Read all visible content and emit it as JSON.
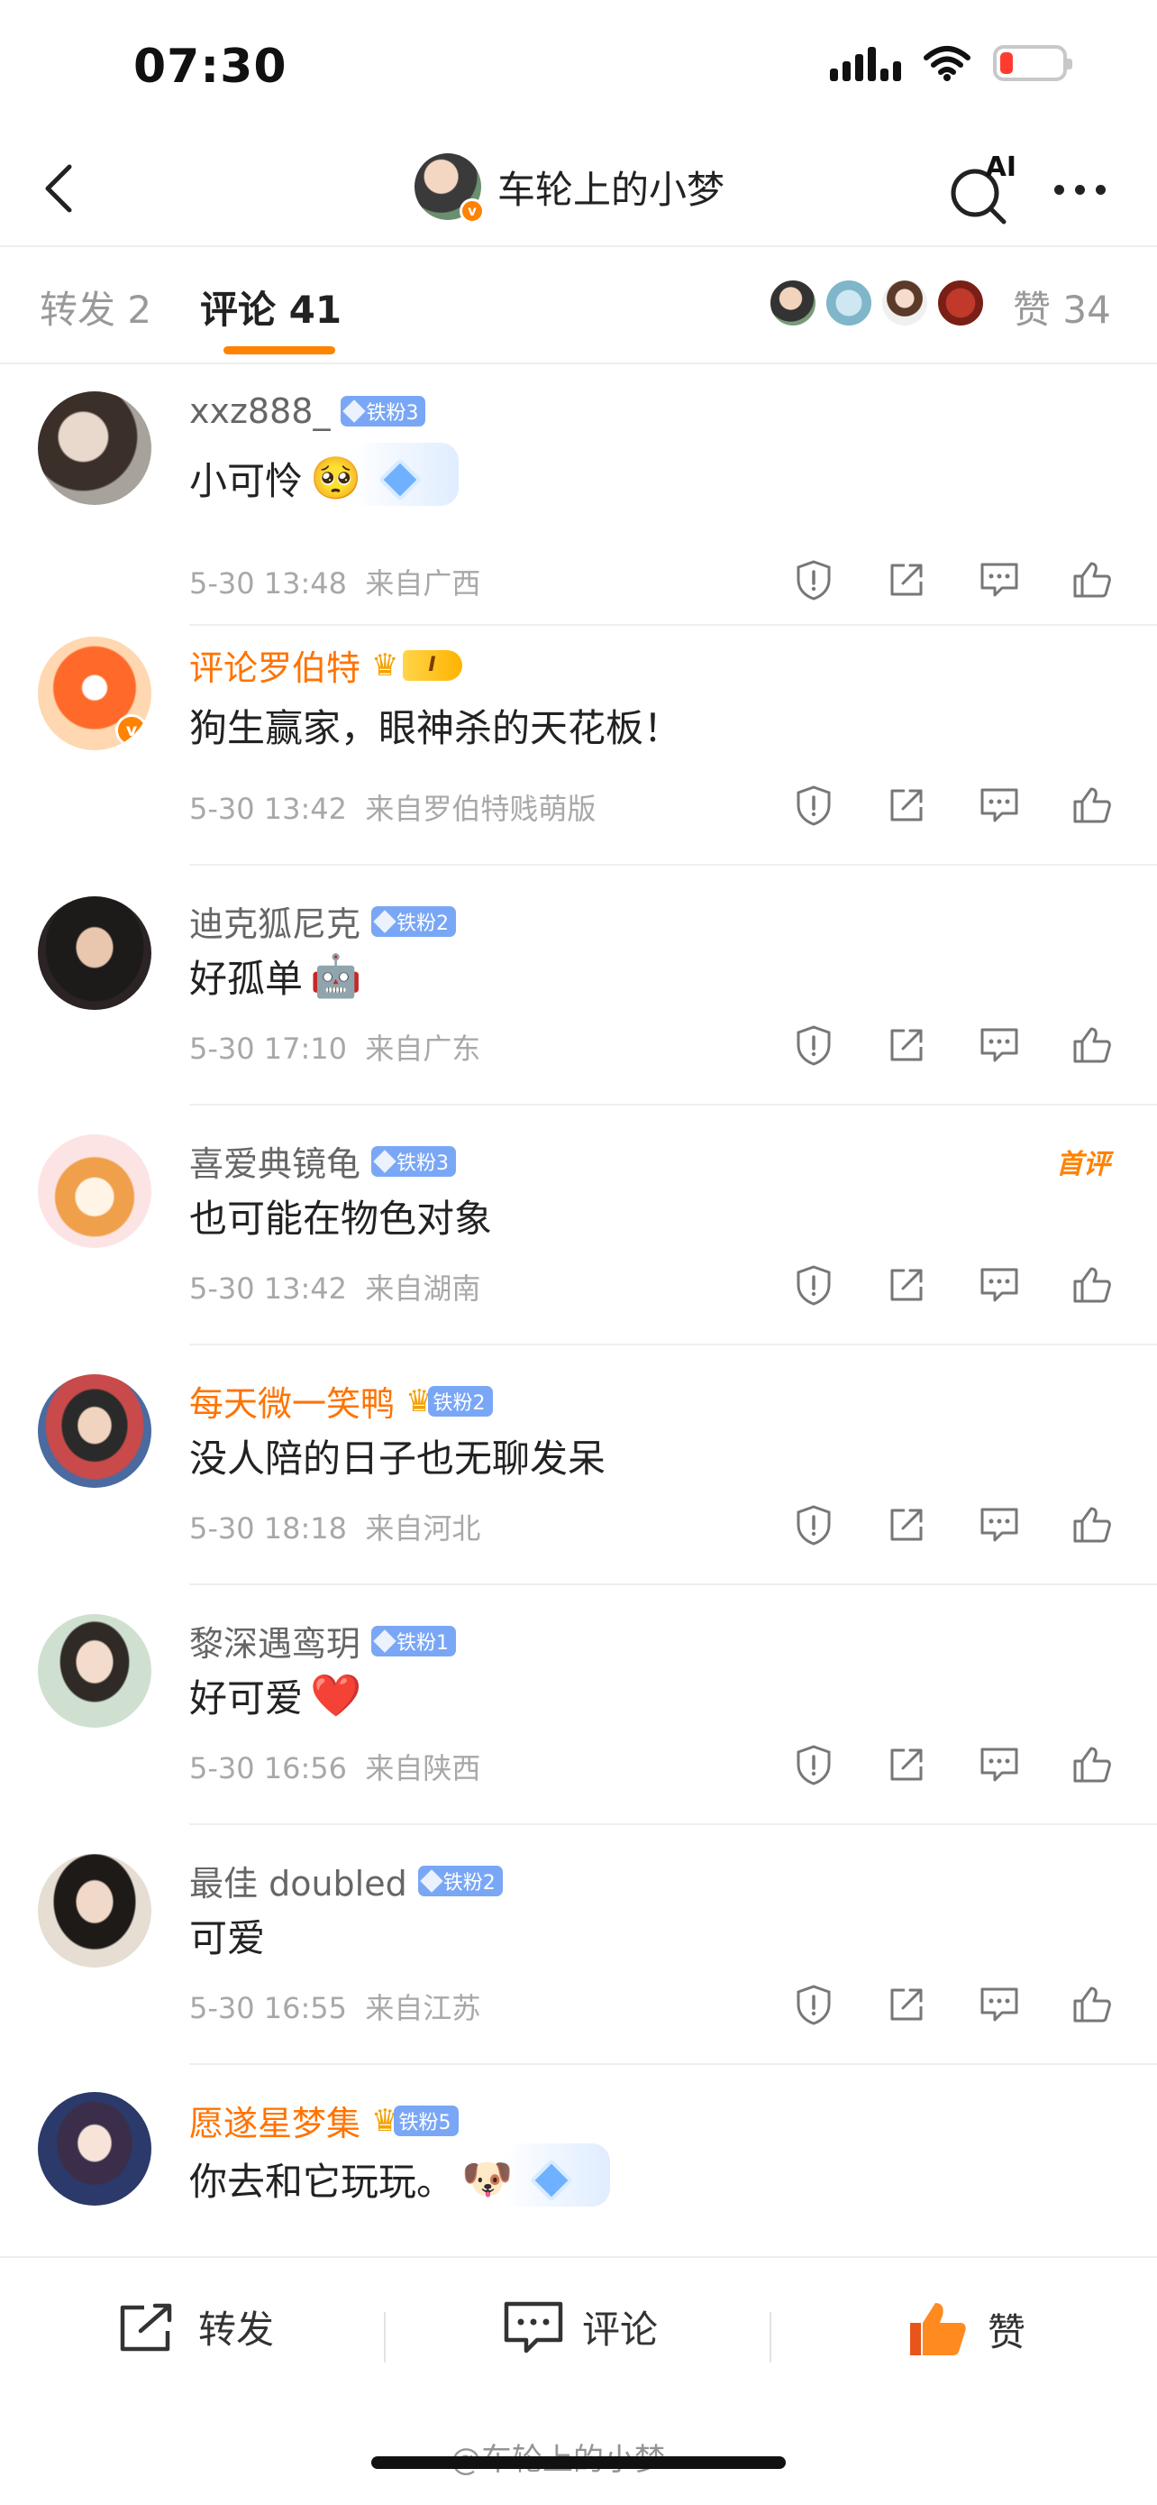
{
  "status_bar": {
    "time": "07:30"
  },
  "nav": {
    "title": "车轮上的小梦",
    "ai_label": "AI"
  },
  "tabs": {
    "repost_label": "转发 2",
    "comment_label": "评论 41",
    "like_label": "赞 34"
  },
  "comments": [
    {
      "name": "xxz888_",
      "name_color": "gray",
      "badge": "铁粉3",
      "text": "小可怜",
      "emoji": "🥺",
      "sparkle": true,
      "time": "5-30 13:48",
      "location": "来自广西"
    },
    {
      "name": "评论罗伯特",
      "name_color": "orange",
      "badge_level": "I",
      "text": "狗生赢家，眼神杀的天花板！",
      "time": "5-30 13:42",
      "location": "来自罗伯特贱萌版"
    },
    {
      "name": "迪克狐尼克",
      "name_color": "gray",
      "badge": "铁粉2",
      "text": "好孤单",
      "emoji": "🤖",
      "time": "5-30 17:10",
      "location": "来自广东"
    },
    {
      "name": "喜爱典镜龟",
      "name_color": "gray",
      "badge": "铁粉3",
      "text": "也可能在物色对象",
      "time": "5-30 13:42",
      "location": "来自湖南",
      "tag": "首评"
    },
    {
      "name": "每天微一笑鸭",
      "name_color": "orange",
      "badge": "铁粉2",
      "crown": true,
      "text": "没人陪的日子也无聊发呆",
      "time": "5-30 18:18",
      "location": "来自河北"
    },
    {
      "name": "黎深遇鸾玥",
      "name_color": "gray",
      "badge": "铁粉1",
      "text": "好可爱",
      "emoji": "❤️",
      "time": "5-30 16:56",
      "location": "来自陕西"
    },
    {
      "name": "最佳 doubled",
      "name_color": "gray",
      "badge": "铁粉2",
      "text": "可爱",
      "time": "5-30 16:55",
      "location": "来自江苏"
    },
    {
      "name": "愿遂星梦集",
      "name_color": "orange",
      "badge": "铁粉5",
      "crown": true,
      "text": "你去和它玩玩。",
      "emoji": "🐶",
      "sparkle": true
    }
  ],
  "bottom_bar": {
    "repost_label": "转发",
    "comment_label": "评论",
    "like_label": "赞"
  },
  "watermark": "@车轮上的小梦",
  "colors": {
    "accent": "#ff8200",
    "fan_badge": "#7aa7f5",
    "meta": "#a8a8a8"
  }
}
